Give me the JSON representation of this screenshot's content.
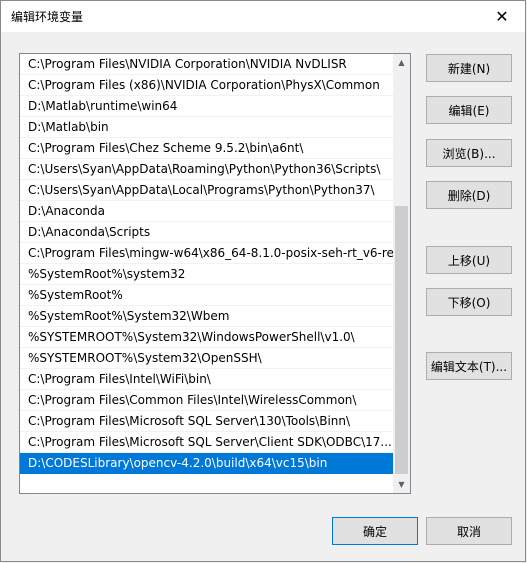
{
  "window": {
    "title": "编辑环境变量",
    "close_symbol": "✕"
  },
  "list": {
    "items": [
      "C:\\Program Files\\NVIDIA Corporation\\NVIDIA NvDLISR",
      "C:\\Program Files (x86)\\NVIDIA Corporation\\PhysX\\Common",
      "D:\\Matlab\\runtime\\win64",
      "D:\\Matlab\\bin",
      "C:\\Program Files\\Chez Scheme 9.5.2\\bin\\a6nt\\",
      "C:\\Users\\Syan\\AppData\\Roaming\\Python\\Python36\\Scripts\\",
      "C:\\Users\\Syan\\AppData\\Local\\Programs\\Python\\Python37\\",
      "D:\\Anaconda",
      "D:\\Anaconda\\Scripts",
      "C:\\Program Files\\mingw-w64\\x86_64-8.1.0-posix-seh-rt_v6-re...",
      "%SystemRoot%\\system32",
      "%SystemRoot%",
      "%SystemRoot%\\System32\\Wbem",
      "%SYSTEMROOT%\\System32\\WindowsPowerShell\\v1.0\\",
      "%SYSTEMROOT%\\System32\\OpenSSH\\",
      "C:\\Program Files\\Intel\\WiFi\\bin\\",
      "C:\\Program Files\\Common Files\\Intel\\WirelessCommon\\",
      "C:\\Program Files\\Microsoft SQL Server\\130\\Tools\\Binn\\",
      "C:\\Program Files\\Microsoft SQL Server\\Client SDK\\ODBC\\17...",
      "D:\\CODESLibrary\\opencv-4.2.0\\build\\x64\\vc15\\bin"
    ],
    "selected_index": 19,
    "scroll_up_symbol": "▲",
    "scroll_down_symbol": "▼"
  },
  "buttons": {
    "new": "新建(N)",
    "edit": "编辑(E)",
    "browse": "浏览(B)...",
    "delete": "删除(D)",
    "move_up": "上移(U)",
    "move_down": "下移(O)",
    "edit_text": "编辑文本(T)...",
    "ok": "确定",
    "cancel": "取消"
  },
  "colors": {
    "selection": "#0078d7",
    "primary_border": "#0078d7"
  }
}
